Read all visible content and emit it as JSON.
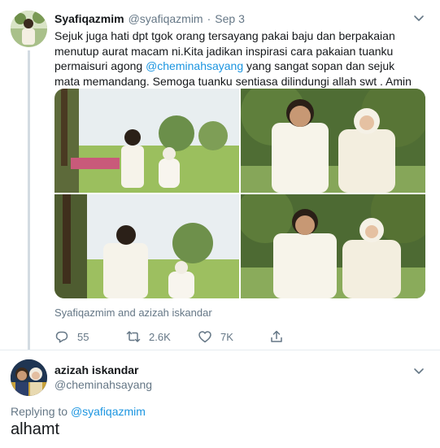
{
  "tweet": {
    "author_name": "Syafiqazmim",
    "author_handle": "@syafiqazmim",
    "separator": "·",
    "date": "Sep 3",
    "text_parts": {
      "before_mention": "Sejuk juga hati dpt tgok orang tersayang pakai baju dan berpakaian menutup aurat macam ni.Kita jadikan inspirasi cara pakaian tuanku permaisuri agong ",
      "mention": "@cheminahsayang",
      "after_mention": " yang sangat sopan dan sejuk mata memandang. Semoga tuanku sentiasa dilindungi allah swt . Amin"
    },
    "tagged_text": "Syafiqazmim and azizah iskandar",
    "reply_count": "55",
    "retweet_count": "2.6K",
    "like_count": "7K",
    "icons": {
      "reply": "reply-icon",
      "retweet": "retweet-icon",
      "like": "heart-icon",
      "share": "share-icon",
      "more": "chevron-down-icon",
      "emoji": "folded-hands-emoji"
    }
  },
  "reply": {
    "author_name": "azizah iskandar",
    "author_handle": "@cheminahsayang",
    "replying_to_label": "Replying to",
    "replying_to_handle": "@syafiqazmim",
    "text": "alhamt"
  },
  "colors": {
    "text_primary": "#14171a",
    "text_secondary": "#657786",
    "link": "#1b95e0",
    "divider": "#e6ecf0",
    "thread_line": "#d3dbe2"
  }
}
